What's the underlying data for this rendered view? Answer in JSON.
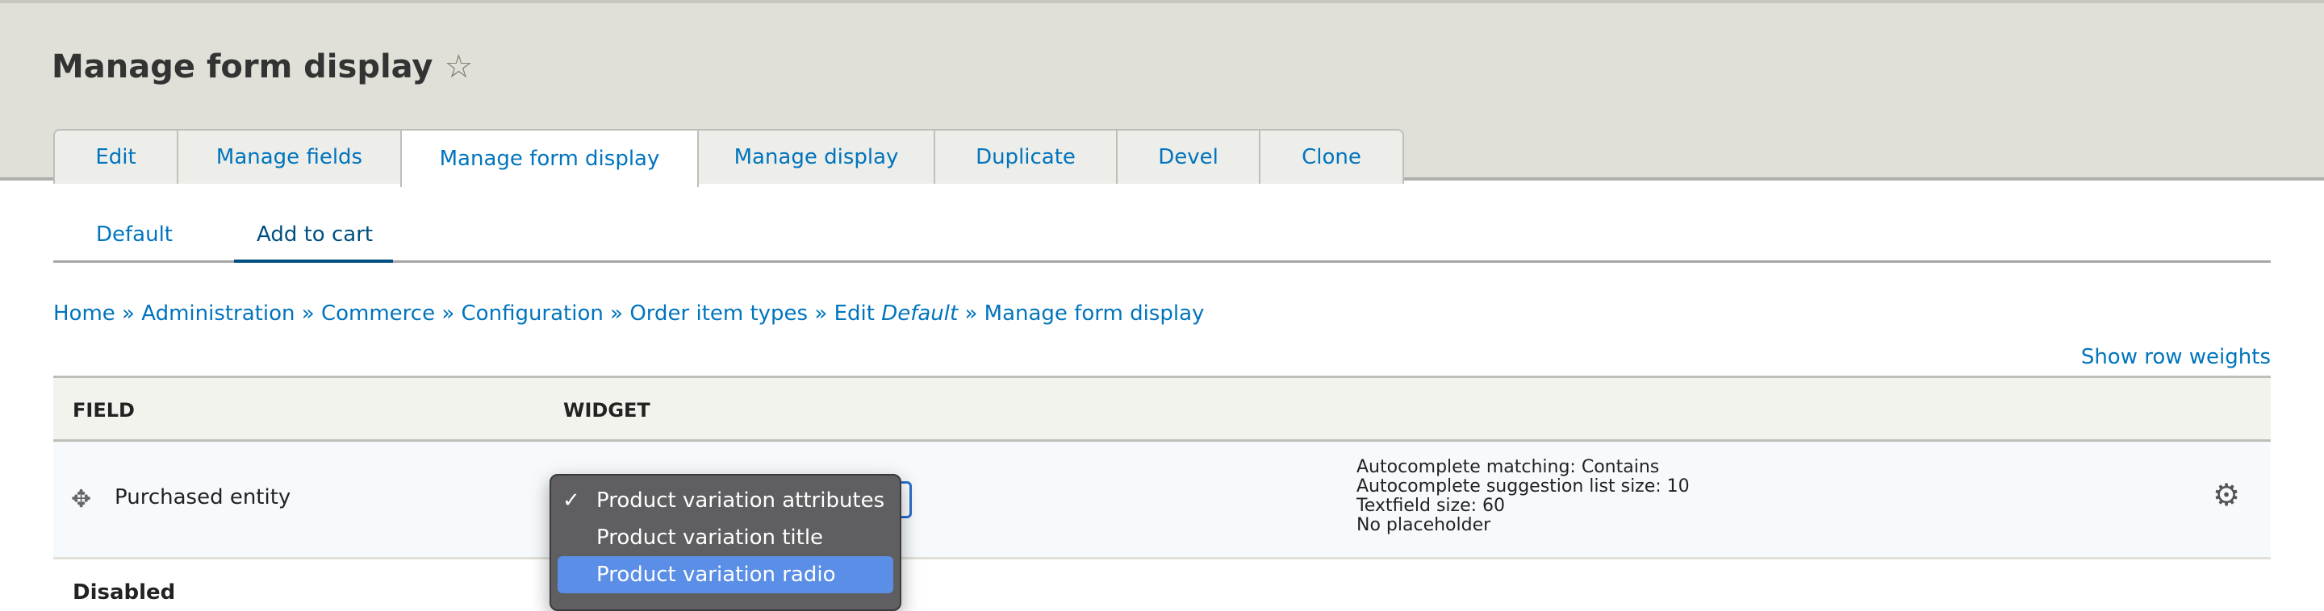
{
  "page": {
    "title": "Manage form display"
  },
  "tabs": [
    {
      "label": "Edit"
    },
    {
      "label": "Manage fields"
    },
    {
      "label": "Manage form display",
      "active": true
    },
    {
      "label": "Manage display"
    },
    {
      "label": "Duplicate"
    },
    {
      "label": "Devel"
    },
    {
      "label": "Clone"
    }
  ],
  "subtabs": [
    {
      "label": "Default"
    },
    {
      "label": "Add to cart",
      "active": true
    }
  ],
  "breadcrumb": {
    "home": "Home",
    "admin": "Administration",
    "commerce": "Commerce",
    "config": "Configuration",
    "types": "Order item types",
    "edit": "Edit",
    "edit_em": "Default",
    "current": "Manage form display",
    "sep": "»"
  },
  "show_row_weights": "Show row weights",
  "table": {
    "headers": {
      "field": "FIELD",
      "widget": "WIDGET"
    },
    "row": {
      "field": "Purchased entity",
      "summary": [
        "Autocomplete matching: Contains",
        "Autocomplete suggestion list size: 10",
        "Textfield size: 60",
        "No placeholder"
      ]
    },
    "disabled_label": "Disabled"
  },
  "dropdown": {
    "options": [
      {
        "label": "Product variation attributes",
        "checked": true
      },
      {
        "label": "Product variation title"
      },
      {
        "label": "Product variation radio",
        "highlighted": true
      }
    ],
    "check": "✓"
  }
}
